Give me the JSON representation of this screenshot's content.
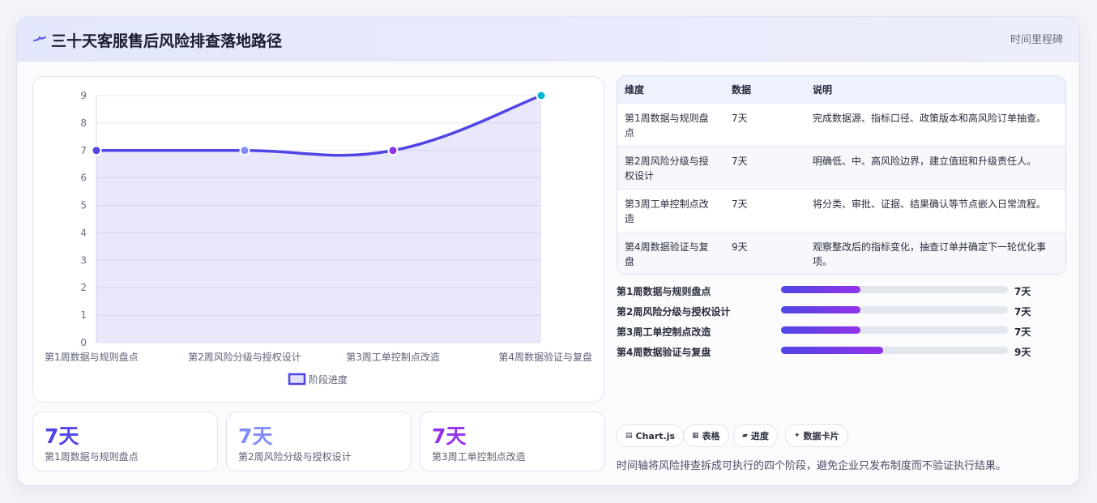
{
  "header": {
    "title": "三十天客服售后风险排查落地路径",
    "badge": "时间里程碑",
    "logo_icon": "pulse-icon"
  },
  "chart_data": {
    "type": "line",
    "categories": [
      "第1周数据与规则盘点",
      "第2周风险分级与授权设计",
      "第3周工单控制点改造",
      "第4周数据验证与复盘"
    ],
    "series": [
      {
        "name": "阶段进度",
        "values": [
          7,
          7,
          7,
          9
        ],
        "color": "#4f46e5",
        "point_colors": [
          "#4f46e5",
          "#818cf8",
          "#9333ea",
          "#06b6d4"
        ]
      }
    ],
    "ylim": [
      0,
      9
    ],
    "yticks": [
      0,
      1,
      2,
      3,
      4,
      5,
      6,
      7,
      8,
      9
    ],
    "fill": "area",
    "grid": true,
    "legend": "bottom"
  },
  "stats": [
    {
      "value": "7天",
      "label": "第1周数据与规则盘点",
      "color": "#4f46e5"
    },
    {
      "value": "7天",
      "label": "第2周风险分级与授权设计",
      "color": "#818cf8"
    },
    {
      "value": "7天",
      "label": "第3周工单控制点改造",
      "color": "#9333ea"
    }
  ],
  "table": {
    "headers": [
      "维度",
      "数据",
      "说明"
    ],
    "rows": [
      [
        "第1周数据与规则盘点",
        "7天",
        "完成数据源、指标口径、政策版本和高风险订单抽查。"
      ],
      [
        "第2周风险分级与授权设计",
        "7天",
        "明确低、中、高风险边界，建立值班和升级责任人。"
      ],
      [
        "第3周工单控制点改造",
        "7天",
        "将分类、审批、证据、结果确认等节点嵌入日常流程。"
      ],
      [
        "第4周数据验证与复盘",
        "9天",
        "观察整改后的指标变化，抽查订单并确定下一轮优化事项。"
      ]
    ]
  },
  "progress": [
    {
      "label": "第1周数据与规则盘点",
      "value": "7天",
      "fraction": 0.35
    },
    {
      "label": "第2周风险分级与授权设计",
      "value": "7天",
      "fraction": 0.35
    },
    {
      "label": "第3周工单控制点改造",
      "value": "7天",
      "fraction": 0.35
    },
    {
      "label": "第4周数据验证与复盘",
      "value": "9天",
      "fraction": 0.45
    }
  ],
  "tags": [
    {
      "icon": "chart-icon",
      "glyph": "▤",
      "label": "Chart.js"
    },
    {
      "icon": "table-icon",
      "glyph": "▦",
      "label": "表格"
    },
    {
      "icon": "progress-icon",
      "glyph": "▰",
      "label": "进度"
    },
    {
      "icon": "sparkle-icon",
      "glyph": "✦",
      "label": "数据卡片"
    }
  ],
  "summary": "时间轴将风险排查拆成可执行的四个阶段，避免企业只发布制度而不验证执行结果。"
}
